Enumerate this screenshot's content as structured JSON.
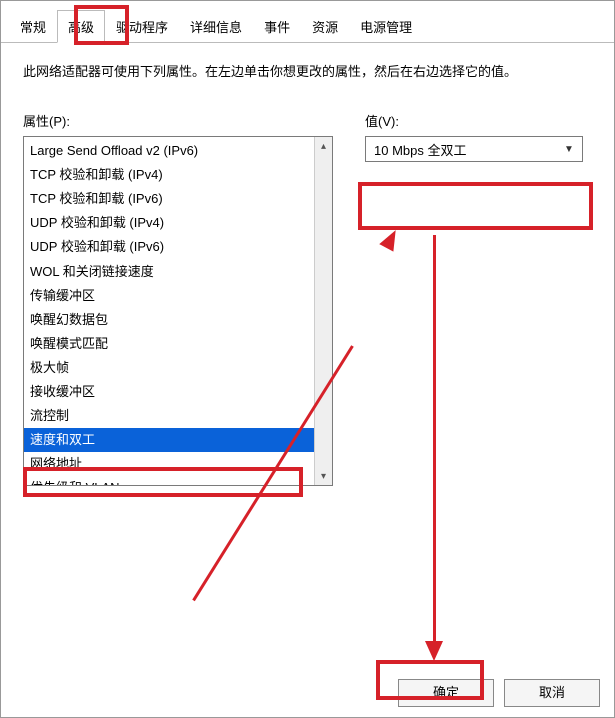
{
  "tabs": {
    "general": "常规",
    "advanced": "高级",
    "driver": "驱动程序",
    "details": "详细信息",
    "events": "事件",
    "resources": "资源",
    "power": "电源管理"
  },
  "description": "此网络适配器可使用下列属性。在左边单击你想更改的属性，然后在右边选择它的值。",
  "property": {
    "label": "属性(P):",
    "items": [
      "Large Send Offload v2 (IPv6)",
      "TCP 校验和卸载 (IPv4)",
      "TCP 校验和卸载 (IPv6)",
      "UDP 校验和卸载 (IPv4)",
      "UDP 校验和卸载 (IPv6)",
      "WOL 和关闭链接速度",
      "传输缓冲区",
      "唤醒幻数据包",
      "唤醒模式匹配",
      "极大帧",
      "接收缓冲区",
      "流控制",
      "速度和双工",
      "网络地址",
      "优先级和 VLAN"
    ],
    "selected_index": 12
  },
  "value": {
    "label": "值(V):",
    "selected": "10 Mbps 全双工"
  },
  "buttons": {
    "ok": "确定",
    "cancel": "取消"
  }
}
